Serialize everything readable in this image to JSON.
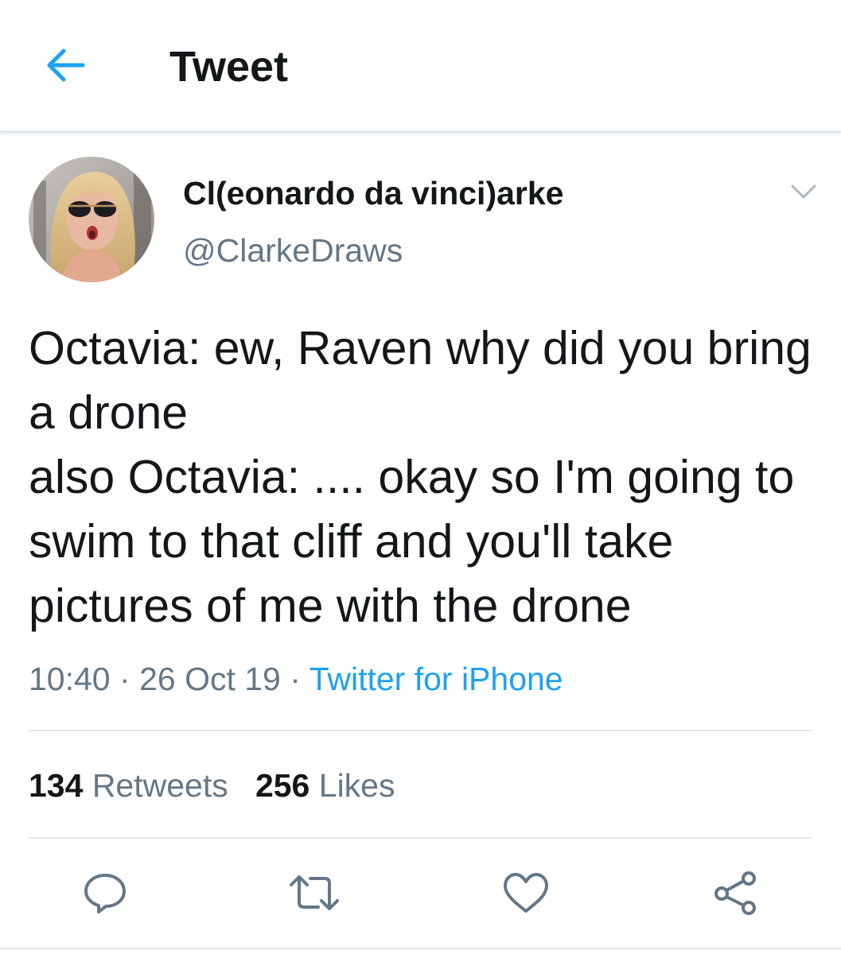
{
  "header": {
    "back_icon": "arrow-left-icon",
    "title": "Tweet"
  },
  "author": {
    "avatar": "profile-photo",
    "name": "Cl(eonardo da vinci)arke",
    "handle": "@ClarkeDraws",
    "menu_icon": "chevron-down-icon"
  },
  "tweet": {
    "text": "Octavia: ew, Raven why did you bring a drone\nalso Octavia: .... okay so I'm going to swim to that cliff and you'll take pictures of me with the drone",
    "time": "10:40",
    "separator": "·",
    "date": "26 Oct 19",
    "source": "Twitter for iPhone"
  },
  "stats": {
    "retweets_count": "134",
    "retweets_label": "Retweets",
    "likes_count": "256",
    "likes_label": "Likes"
  },
  "actions": [
    {
      "icon": "reply-icon"
    },
    {
      "icon": "retweet-icon"
    },
    {
      "icon": "heart-icon"
    },
    {
      "icon": "share-icon"
    }
  ],
  "colors": {
    "accent": "#1da1f2",
    "secondary_text": "#657786",
    "primary_text": "#14171a",
    "divider": "#e1e8ed"
  }
}
